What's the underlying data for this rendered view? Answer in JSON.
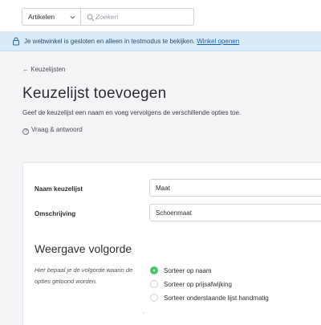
{
  "topbar": {
    "select_value": "Artikelen",
    "search_placeholder": "Zoeken"
  },
  "banner": {
    "message": "Je webwinkel is gesloten en alleen in testmodus te bekijken.",
    "link": "Winkel openen"
  },
  "header": {
    "back_label": "Keuzelijsten",
    "title": "Keuzelijst toevoegen",
    "description": "Geef de keuzelijst een naam en voeg vervolgens de verschillende opties toe.",
    "help_label": "Vraag & antwoord"
  },
  "form": {
    "name_label": "Naam keuzelijst",
    "name_value": "Maat",
    "desc_label": "Omschrijving",
    "desc_value": "Schoenmaat"
  },
  "display_order": {
    "title": "Weergave volgorde",
    "hint": "Hier bepaal je de volgorde waarin de opties getoond worden.",
    "options": [
      {
        "label": "Sorteer op naam",
        "selected": true
      },
      {
        "label": "Sorteer op prijsafwijking",
        "selected": false
      },
      {
        "label": "Sorteer onderstaande lijst handmatig",
        "selected": false
      }
    ]
  },
  "colors": {
    "accent_green": "#4cc36e",
    "banner_bg": "#d9ebf8",
    "link_blue": "#1b5fa8"
  }
}
